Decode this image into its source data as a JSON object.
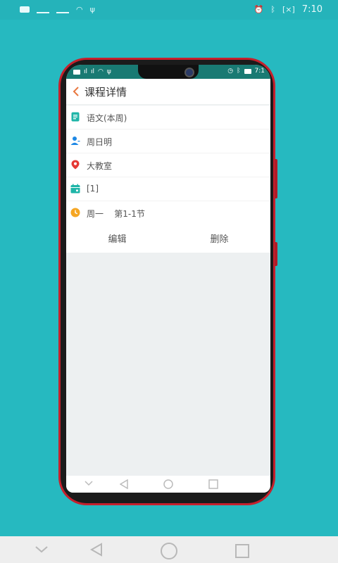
{
  "outer_status": {
    "time": "7:10",
    "battery_label": "[×]"
  },
  "inner_status": {
    "time": "7:1"
  },
  "header": {
    "title": "课程详情"
  },
  "details": [
    {
      "icon": "document-icon",
      "label": "语文(本周)"
    },
    {
      "icon": "person-icon",
      "label": "周日明"
    },
    {
      "icon": "location-pin-icon",
      "label": "大教室"
    },
    {
      "icon": "calendar-icon",
      "label": "[1]"
    },
    {
      "icon": "clock-icon",
      "label": "周一    第1-1节"
    }
  ],
  "actions": {
    "edit_label": "编辑",
    "delete_label": "删除"
  },
  "colors": {
    "background": "#26b9c0",
    "frame": "#c5202c",
    "accent_teal": "#1fb5a8",
    "accent_blue": "#1e88e5",
    "accent_red": "#e53935",
    "accent_orange": "#f5a623",
    "back_arrow": "#e8773f"
  }
}
